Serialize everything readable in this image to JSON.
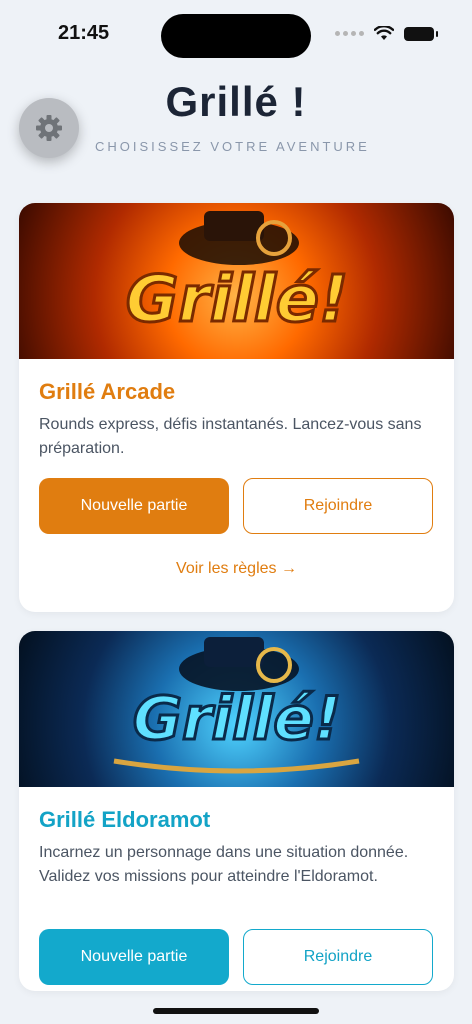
{
  "status_bar": {
    "time": "21:45"
  },
  "header": {
    "title": "Grillé !",
    "subtitle": "CHOISISSEZ VOTRE AVENTURE"
  },
  "settings": {
    "icon": "gear-icon"
  },
  "cards": [
    {
      "banner_text": "Grillé!",
      "title": "Grillé Arcade",
      "description": "Rounds express, défis instantanés. Lancez-vous sans préparation.",
      "primary_label": "Nouvelle partie",
      "secondary_label": "Rejoindre",
      "rules_label": "Voir les règles →",
      "accent": "#e07d10"
    },
    {
      "banner_text": "Grillé!",
      "title": "Grillé Eldoramot",
      "description": "Incarnez un personnage dans une situation donnée. Validez vos missions pour atteindre l'Eldoramot.",
      "primary_label": "Nouvelle partie",
      "secondary_label": "Rejoindre",
      "accent": "#13a9cc"
    }
  ]
}
